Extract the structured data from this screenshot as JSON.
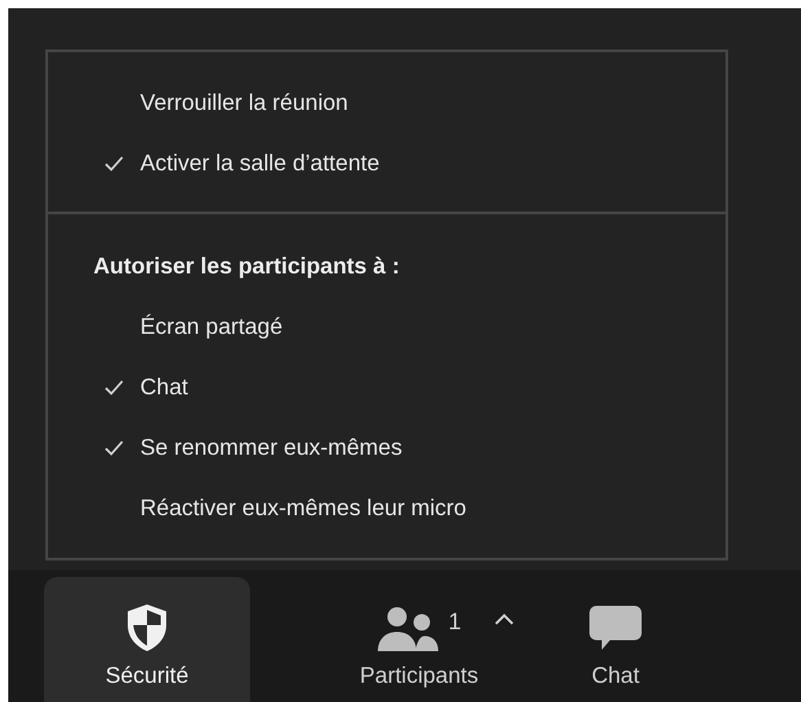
{
  "menu": {
    "sections": [
      {
        "items": [
          {
            "kind": "option",
            "label": "Verrouiller la réunion",
            "checked": false
          },
          {
            "kind": "option",
            "label": "Activer la salle d’attente",
            "checked": true
          }
        ]
      },
      {
        "items": [
          {
            "kind": "header",
            "label": "Autoriser les participants à :"
          },
          {
            "kind": "option",
            "label": "Écran partagé",
            "checked": false
          },
          {
            "kind": "option",
            "label": "Chat",
            "checked": true
          },
          {
            "kind": "option",
            "label": "Se renommer eux-mêmes",
            "checked": true
          },
          {
            "kind": "option",
            "label": "Réactiver eux-mêmes leur micro",
            "checked": false
          }
        ]
      }
    ]
  },
  "toolbar": [
    {
      "kind": "security",
      "label": "Sécurité",
      "selected": true
    },
    {
      "kind": "participants",
      "label": "Participants",
      "count": "1",
      "selected": false
    },
    {
      "kind": "chat",
      "label": "Chat",
      "selected": false
    }
  ]
}
